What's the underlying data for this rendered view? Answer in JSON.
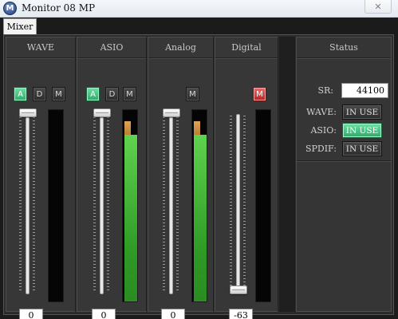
{
  "window": {
    "title": "Monitor 08 MP",
    "logo_letter": "M",
    "close_glyph": "✕"
  },
  "tabs": [
    {
      "label": "Mixer",
      "selected": true
    }
  ],
  "channels": [
    {
      "name": "WAVE",
      "buttons": [
        {
          "label": "A",
          "state": "on"
        },
        {
          "label": "D",
          "state": "off"
        },
        {
          "label": "M",
          "state": "off"
        }
      ],
      "fader_value": "0",
      "fader_level": 1.0,
      "meter_level": 0.0,
      "peak_level": 0.0
    },
    {
      "name": "ASIO",
      "buttons": [
        {
          "label": "A",
          "state": "on"
        },
        {
          "label": "D",
          "state": "off"
        },
        {
          "label": "M",
          "state": "off"
        }
      ],
      "fader_value": "0",
      "fader_level": 1.0,
      "meter_level": 0.87,
      "peak_level": 0.94
    },
    {
      "name": "Analog",
      "buttons": [
        {
          "label": "M",
          "state": "off"
        }
      ],
      "fader_value": "0",
      "fader_level": 1.0,
      "meter_level": 0.87,
      "peak_level": 0.94
    },
    {
      "name": "Digital",
      "buttons": [
        {
          "label": "M",
          "state": "muted"
        }
      ],
      "fader_value": "-63",
      "fader_level": 0.0,
      "meter_level": 0.0,
      "peak_level": 0.0
    }
  ],
  "status": {
    "title": "Status",
    "sr_label": "SR:",
    "sr_value": "44100",
    "rows": [
      {
        "label": "WAVE:",
        "value": "IN USE",
        "active": false
      },
      {
        "label": "ASIO:",
        "value": "IN USE",
        "active": true
      },
      {
        "label": "SPDIF:",
        "value": "IN USE",
        "active": false
      }
    ]
  },
  "colors": {
    "button_on": "#3fbf7f",
    "mute_on": "#d42a2a",
    "meter_green": "#4cc83f",
    "meter_peak": "#c8913f"
  }
}
